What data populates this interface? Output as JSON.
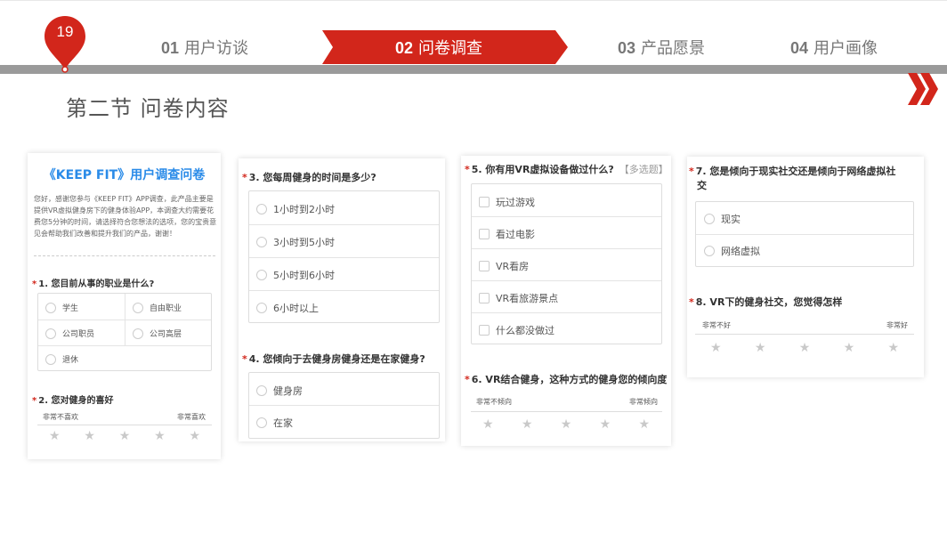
{
  "page_number": "19",
  "tabs": [
    {
      "num": "01",
      "label": "用户访谈"
    },
    {
      "num": "02",
      "label": "问卷调查"
    },
    {
      "num": "03",
      "label": "产品愿景"
    },
    {
      "num": "04",
      "label": "用户画像"
    }
  ],
  "active_tab_index": 1,
  "section_title": "第二节  问卷内容",
  "colors": {
    "accent": "#d2261b",
    "title_blue": "#2a8be8",
    "bar_grey": "#9a9a9a"
  },
  "card1": {
    "title": "《KEEP FIT》用户调查问卷",
    "intro": "您好，感谢您参与《KEEP FIT》APP调查，此产品主要是提供VR虚拟健身房下的健身体验APP，本调查大约需要花费您5分钟的时间，请选择符合您想法的选项，您的宝贵意见会帮助我们改善和提升我们的产品，谢谢！",
    "q1": {
      "text": "1. 您目前从事的职业是什么?",
      "options": [
        "学生",
        "自由职业",
        "公司职员",
        "公司高层",
        "退休"
      ]
    },
    "q2": {
      "text": "2. 您对健身的喜好",
      "low": "非常不喜欢",
      "high": "非常喜欢"
    }
  },
  "card2": {
    "q3": {
      "text": "3. 您每周健身的时间是多少?",
      "options": [
        "1小时到2小时",
        "3小时到5小时",
        "5小时到6小时",
        "6小时以上"
      ]
    },
    "q4": {
      "text": "4. 您倾向于去健身房健身还是在家健身?",
      "options": [
        "健身房",
        "在家"
      ]
    }
  },
  "card3": {
    "q5": {
      "text": "5. 你有用VR虚拟设备做过什么?",
      "tag": "【多选题】",
      "options": [
        "玩过游戏",
        "看过电影",
        "VR看房",
        "VR看旅游景点",
        "什么都没做过"
      ]
    },
    "q6": {
      "text": "6. VR结合健身，这种方式的健身您的倾向度",
      "low": "非常不倾向",
      "high": "非常倾向"
    }
  },
  "card4": {
    "q7": {
      "text_line1": "7. 您是倾向于现实社交还是倾向于网络虚拟社",
      "text_line2": "交",
      "options": [
        "现实",
        "网络虚拟"
      ]
    },
    "q8": {
      "text": "8. VR下的健身社交，您觉得怎样",
      "low": "非常不好",
      "high": "非常好"
    }
  },
  "required_mark": "*",
  "star_glyph": "★"
}
